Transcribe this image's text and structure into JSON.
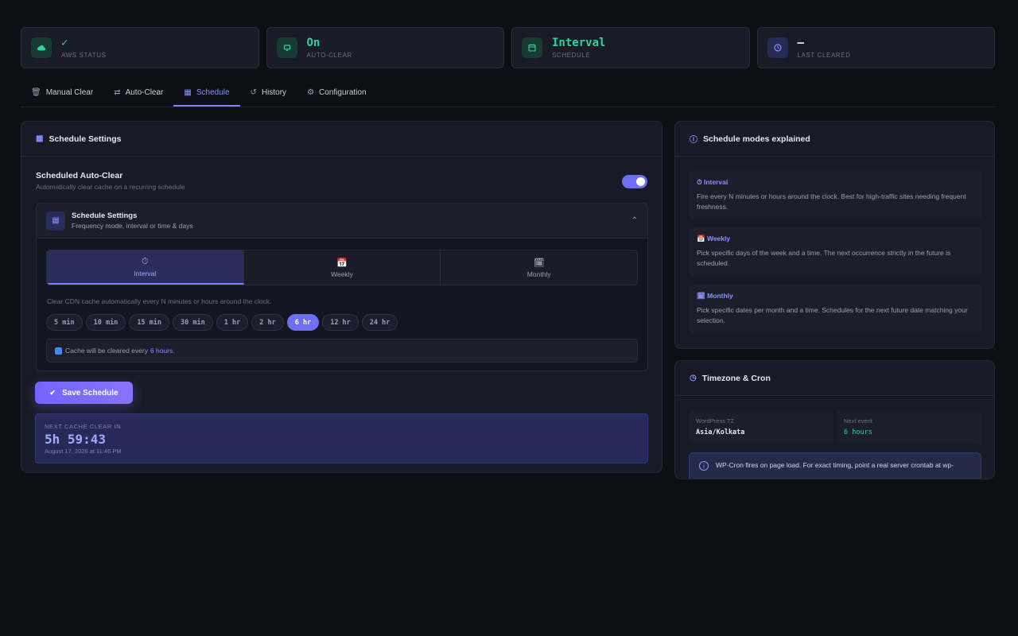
{
  "stats": [
    {
      "value": "✓",
      "label": "AWS STATUS",
      "icon": "cloud-icon"
    },
    {
      "value": "On",
      "label": "AUTO-CLEAR",
      "icon": "auto-clear-icon"
    },
    {
      "value": "Interval",
      "label": "SCHEDULE",
      "icon": "calendar-icon"
    },
    {
      "value": "–",
      "label": "LAST CLEARED",
      "icon": "clock-icon"
    }
  ],
  "tabs": [
    {
      "label": "Manual Clear",
      "icon": "trash-icon"
    },
    {
      "label": "Auto-Clear",
      "icon": "repeat-icon"
    },
    {
      "label": "Schedule",
      "icon": "calendar-icon"
    },
    {
      "label": "History",
      "icon": "history-icon"
    },
    {
      "label": "Configuration",
      "icon": "gear-icon"
    }
  ],
  "active_tab": "Schedule",
  "main": {
    "title": "Schedule Settings",
    "toggle": {
      "title": "Scheduled Auto-Clear",
      "subtitle": "Automatically clear cache on a recurring schedule",
      "enabled": true
    },
    "sub": {
      "title": "Schedule Settings",
      "desc": "Frequency mode, interval or time & days"
    },
    "modes": [
      {
        "label": "Interval",
        "icon": "timer-icon"
      },
      {
        "label": "Weekly",
        "icon": "calendar-icon"
      },
      {
        "label": "Monthly",
        "icon": "monthly-icon"
      }
    ],
    "active_mode": "Interval",
    "interval_note": "Clear CDN cache automatically every N minutes or hours around the clock.",
    "intervals": [
      "5 min",
      "10 min",
      "15 min",
      "30 min",
      "1 hr",
      "2 hr",
      "6 hr",
      "12 hr",
      "24 hr"
    ],
    "selected_interval": "6 hr",
    "info_prefix": "Cache will be cleared every",
    "info_value": "6 hours",
    "info_suffix": ".",
    "save_label": "Save Schedule",
    "countdown": {
      "label": "NEXT CACHE CLEAR IN",
      "value": "5h 59:43",
      "date": "August 17, 2026 at 11:46 PM"
    }
  },
  "modes_explained": {
    "title": "Schedule modes explained",
    "items": [
      {
        "title": "Interval",
        "text": "Fire every N minutes or hours around the clock. Best for high-traffic sites needing frequent freshness."
      },
      {
        "title": "Weekly",
        "text": "Pick specific days of the week and a time. The next occurrence strictly in the future is scheduled."
      },
      {
        "title": "Monthly",
        "text": "Pick specific dates per month and a time. Schedules for the next future date matching your selection."
      }
    ]
  },
  "timezone": {
    "title": "Timezone & Cron",
    "wp_tz_label": "WordPress TZ",
    "wp_tz_value": "Asia/Kolkata",
    "next_event_label": "Next event",
    "next_event_value": "6 hours",
    "note": "WP-Cron fires on page load. For exact timing, point a real server crontab at wp-"
  },
  "colors": {
    "accent": "#7c83ff",
    "success": "#2fd39a",
    "background": "#0e0f14"
  }
}
